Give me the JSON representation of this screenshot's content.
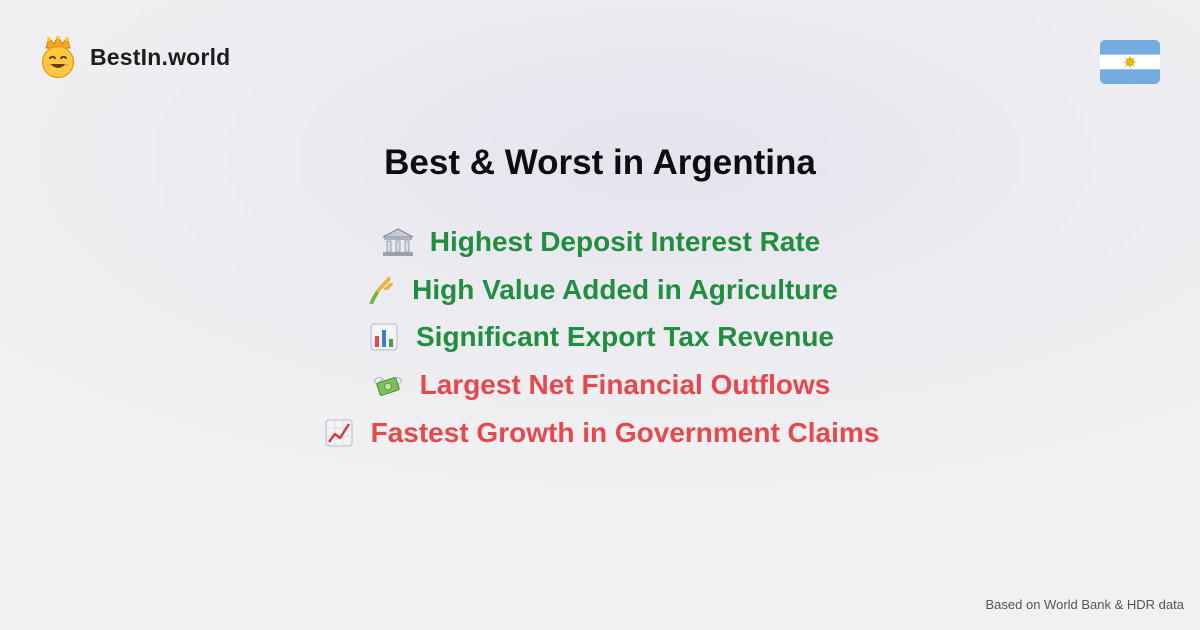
{
  "brand": {
    "name": "BestIn.world",
    "logo_icon": "crowned-smiley-icon"
  },
  "country_flag": {
    "icon": "argentina-flag-icon",
    "colors": [
      "#74acdf",
      "#ffffff",
      "#74acdf"
    ],
    "sun_color": "#f6b40e"
  },
  "title": "Best & Worst in Argentina",
  "items": [
    {
      "label": "Highest Deposit Interest Rate",
      "icon": "bank-icon",
      "kind": "best"
    },
    {
      "label": "High Value Added in Agriculture",
      "icon": "sheaf-of-rice-icon",
      "kind": "best"
    },
    {
      "label": "Significant Export Tax Revenue",
      "icon": "bar-chart-icon",
      "kind": "best"
    },
    {
      "label": "Largest Net Financial Outflows",
      "icon": "money-with-wings-icon",
      "kind": "worst"
    },
    {
      "label": "Fastest Growth in Government Claims",
      "icon": "chart-increasing-icon",
      "kind": "worst"
    }
  ],
  "colors": {
    "best": "#1f8f3f",
    "worst": "#e5484d"
  },
  "footer": "Based on World Bank & HDR data"
}
